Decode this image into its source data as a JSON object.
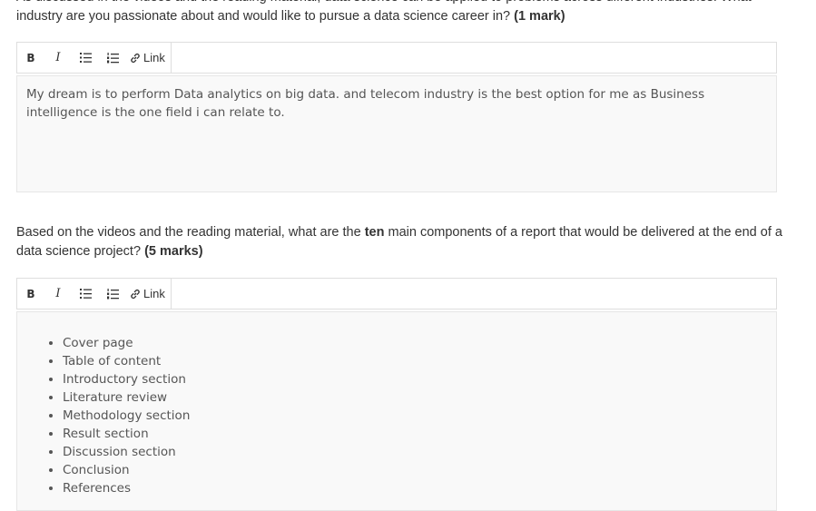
{
  "q1": {
    "cutoff_line": "As discussed in the videos and the reading material, data science can be applied to problems across different industries. What",
    "line2_text": "industry are you passionate about and would like to pursue a data science career in?",
    "marks": "(1 mark)",
    "answer": "My dream is to perform Data analytics on big data. and telecom industry is the best option for me as Business intelligence is the one field i can relate to."
  },
  "toolbar": {
    "bold": "B",
    "italic": "I",
    "link": "Link"
  },
  "q2": {
    "text_before": "Based on the videos and the reading material, what are the",
    "emphasis": "ten",
    "text_after": "main components of a report that would be delivered at the end of a data science project?",
    "marks": "(5 marks)",
    "answer_items": [
      "Cover page",
      "Table of content",
      "Introductory section",
      "Literature review",
      "Methodology section",
      "Result section",
      "Discussion section",
      "Conclusion",
      "References"
    ]
  }
}
